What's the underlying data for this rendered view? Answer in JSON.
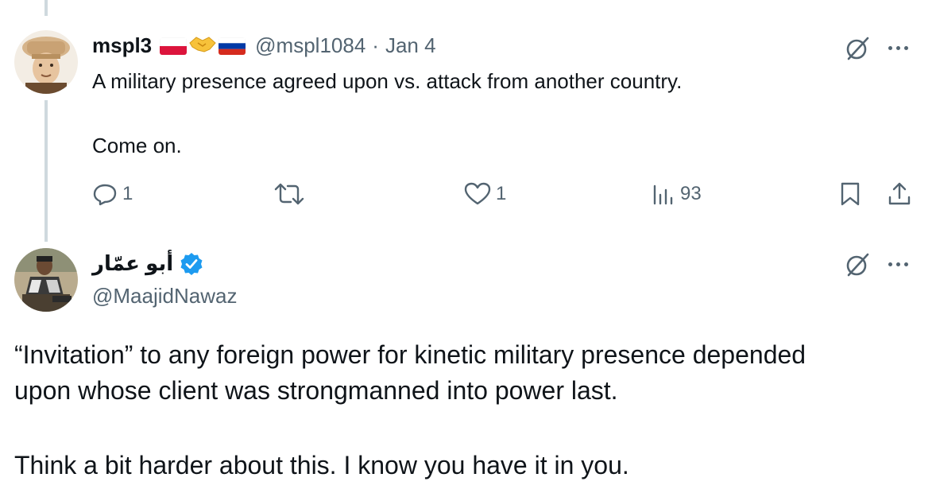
{
  "tweet1": {
    "author_name": "mspl3",
    "handle": "@mspl1084",
    "separator": "·",
    "date": "Jan 4",
    "flags": [
      "poland-flag",
      "handshake-emoji",
      "russia-flag"
    ],
    "body_line1": "A military presence agreed upon vs. attack from another country.",
    "body_line2": "Come on.",
    "actions": {
      "reply_count": "1",
      "retweet_count": "",
      "like_count": "1",
      "views_count": "93"
    }
  },
  "tweet2": {
    "author_name": "أبو عمّار",
    "verified": true,
    "handle": "@MaajidNawaz",
    "body_line1": "“Invitation” to any foreign power for kinetic military presence depended",
    "body_line2": "upon whose client was strongmanned into power last.",
    "body_line3": "Think a bit harder about this. I know you have it in you."
  },
  "colors": {
    "text": "#0f1419",
    "secondary": "#536471",
    "thread_line": "#cfd9de",
    "verified": "#1d9bf0"
  }
}
